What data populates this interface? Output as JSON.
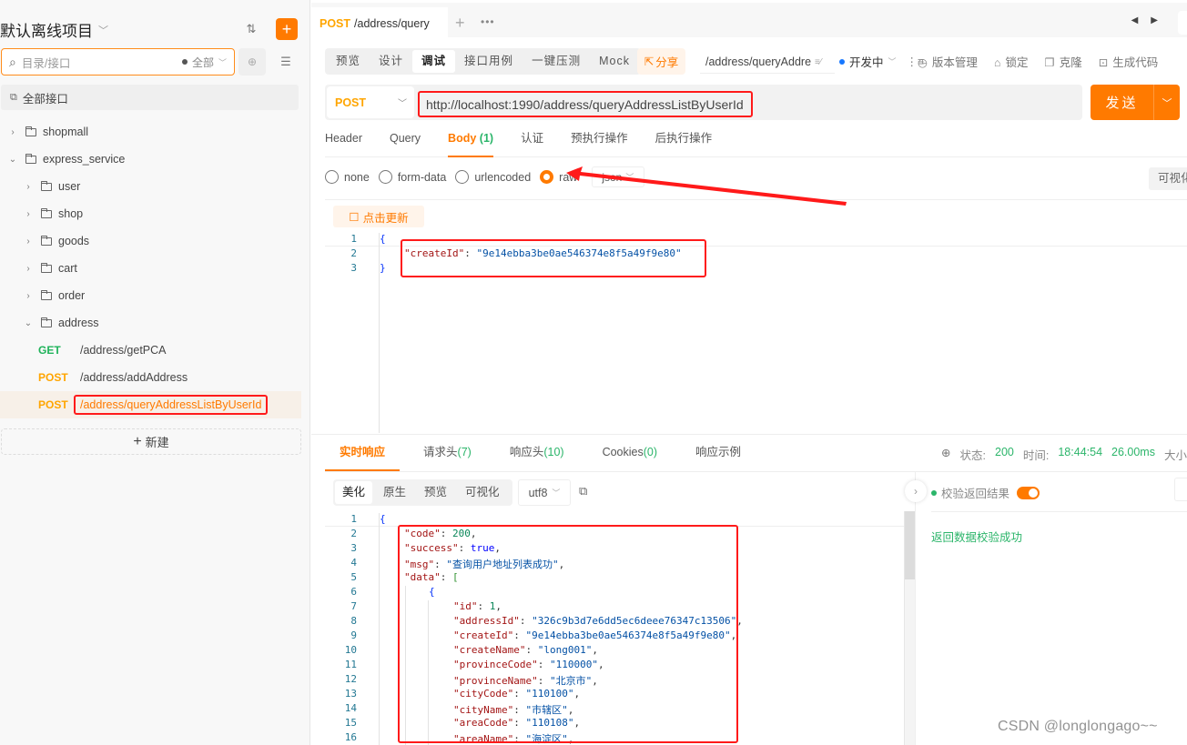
{
  "sidebar": {
    "project_title": "默认离线项目",
    "search_placeholder": "目录/接口",
    "search_filter": "全部",
    "all_apis_label": "全部接口",
    "tree": [
      {
        "type": "folder",
        "label": "shopmall",
        "level": 0,
        "expanded": false
      },
      {
        "type": "folder",
        "label": "express_service",
        "level": 0,
        "expanded": true
      },
      {
        "type": "folder",
        "label": "user",
        "level": 1,
        "expanded": false
      },
      {
        "type": "folder",
        "label": "shop",
        "level": 1,
        "expanded": false
      },
      {
        "type": "folder",
        "label": "goods",
        "level": 1,
        "expanded": false
      },
      {
        "type": "folder",
        "label": "cart",
        "level": 1,
        "expanded": false
      },
      {
        "type": "folder",
        "label": "order",
        "level": 1,
        "expanded": false
      },
      {
        "type": "folder",
        "label": "address",
        "level": 1,
        "expanded": true
      }
    ],
    "apis": [
      {
        "method": "GET",
        "path": "/address/getPCA",
        "active": false
      },
      {
        "method": "POST",
        "path": "/address/addAddress",
        "active": false
      },
      {
        "method": "POST",
        "path": "/address/queryAddressListByUserId",
        "active": true
      }
    ],
    "new_label": "新建"
  },
  "tabs": {
    "active_tab_method": "POST",
    "active_tab_label": "/address/query"
  },
  "modes": [
    "预览",
    "设计",
    "调试",
    "接口用例",
    "一键压测",
    "Mock"
  ],
  "active_mode": "调试",
  "toolbar": {
    "share_label": "分享",
    "api_name": "/address/queryAddre",
    "status_label": "开发中",
    "version_label": "版本管理",
    "lock_label": "锁定",
    "clone_label": "克隆",
    "codegen_label": "生成代码"
  },
  "request": {
    "method": "POST",
    "url": "http://localhost:1990/address/queryAddressListByUserId",
    "send_label": "发送",
    "tabs": [
      {
        "label": "Header",
        "count": ""
      },
      {
        "label": "Query",
        "count": ""
      },
      {
        "label": "Body",
        "count": "(1)"
      },
      {
        "label": "认证",
        "count": ""
      },
      {
        "label": "预执行操作",
        "count": ""
      },
      {
        "label": "后执行操作",
        "count": ""
      }
    ],
    "body_types": [
      "none",
      "form-data",
      "urlencoded",
      "raw"
    ],
    "selected_body_type": "raw",
    "raw_format": "json",
    "visualize_label": "可视化",
    "update_label": "点击更新",
    "body_lines": [
      "{",
      "    \"createId\": \"9e14ebba3be0ae546374e8f5a49f9e80\"",
      "}"
    ],
    "body_key": "createId",
    "body_value": "9e14ebba3be0ae546374e8f5a49f9e80"
  },
  "response": {
    "tabs": [
      {
        "label": "实时响应",
        "count": ""
      },
      {
        "label": "请求头",
        "count": "(7)"
      },
      {
        "label": "响应头",
        "count": "(10)"
      },
      {
        "label": "Cookies",
        "count": "(0)"
      },
      {
        "label": "响应示例",
        "count": ""
      }
    ],
    "status_label": "状态:",
    "status_code": "200",
    "time_label": "时间:",
    "time_value": "18:44:54",
    "duration": "26.00ms",
    "size_label": "大小",
    "formats": [
      "美化",
      "原生",
      "预览",
      "可视化"
    ],
    "encoding": "utf8",
    "validate_label": "校验返回结果",
    "validate_result": "返回数据校验成功",
    "json_lines": [
      {
        "n": 1,
        "indent": 0,
        "key": "",
        "val": "{",
        "type": "brace"
      },
      {
        "n": 2,
        "indent": 1,
        "key": "code",
        "val": "200",
        "type": "num"
      },
      {
        "n": 3,
        "indent": 1,
        "key": "success",
        "val": "true",
        "type": "bool"
      },
      {
        "n": 4,
        "indent": 1,
        "key": "msg",
        "val": "查询用户地址列表成功",
        "type": "str"
      },
      {
        "n": 5,
        "indent": 1,
        "key": "data",
        "val": "[",
        "type": "bracket"
      },
      {
        "n": 6,
        "indent": 2,
        "key": "",
        "val": "{",
        "type": "brace2"
      },
      {
        "n": 7,
        "indent": 3,
        "key": "id",
        "val": "1",
        "type": "num"
      },
      {
        "n": 8,
        "indent": 3,
        "key": "addressId",
        "val": "326c9b3d7e6dd5ec6deee76347c13506",
        "type": "str"
      },
      {
        "n": 9,
        "indent": 3,
        "key": "createId",
        "val": "9e14ebba3be0ae546374e8f5a49f9e80",
        "type": "str"
      },
      {
        "n": 10,
        "indent": 3,
        "key": "createName",
        "val": "long001",
        "type": "str"
      },
      {
        "n": 11,
        "indent": 3,
        "key": "provinceCode",
        "val": "110000",
        "type": "str"
      },
      {
        "n": 12,
        "indent": 3,
        "key": "provinceName",
        "val": "北京市",
        "type": "str"
      },
      {
        "n": 13,
        "indent": 3,
        "key": "cityCode",
        "val": "110100",
        "type": "str"
      },
      {
        "n": 14,
        "indent": 3,
        "key": "cityName",
        "val": "市辖区",
        "type": "str"
      },
      {
        "n": 15,
        "indent": 3,
        "key": "areaCode",
        "val": "110108",
        "type": "str"
      },
      {
        "n": 16,
        "indent": 3,
        "key": "areaName",
        "val": "海淀区",
        "type": "str"
      }
    ]
  },
  "watermark": "CSDN @longlongago~~",
  "colors": {
    "accent": "#ff7a00",
    "get": "#1fb35a",
    "post": "#ffa500",
    "success": "#2bb56a",
    "annotation_red": "#ff1a1a"
  }
}
